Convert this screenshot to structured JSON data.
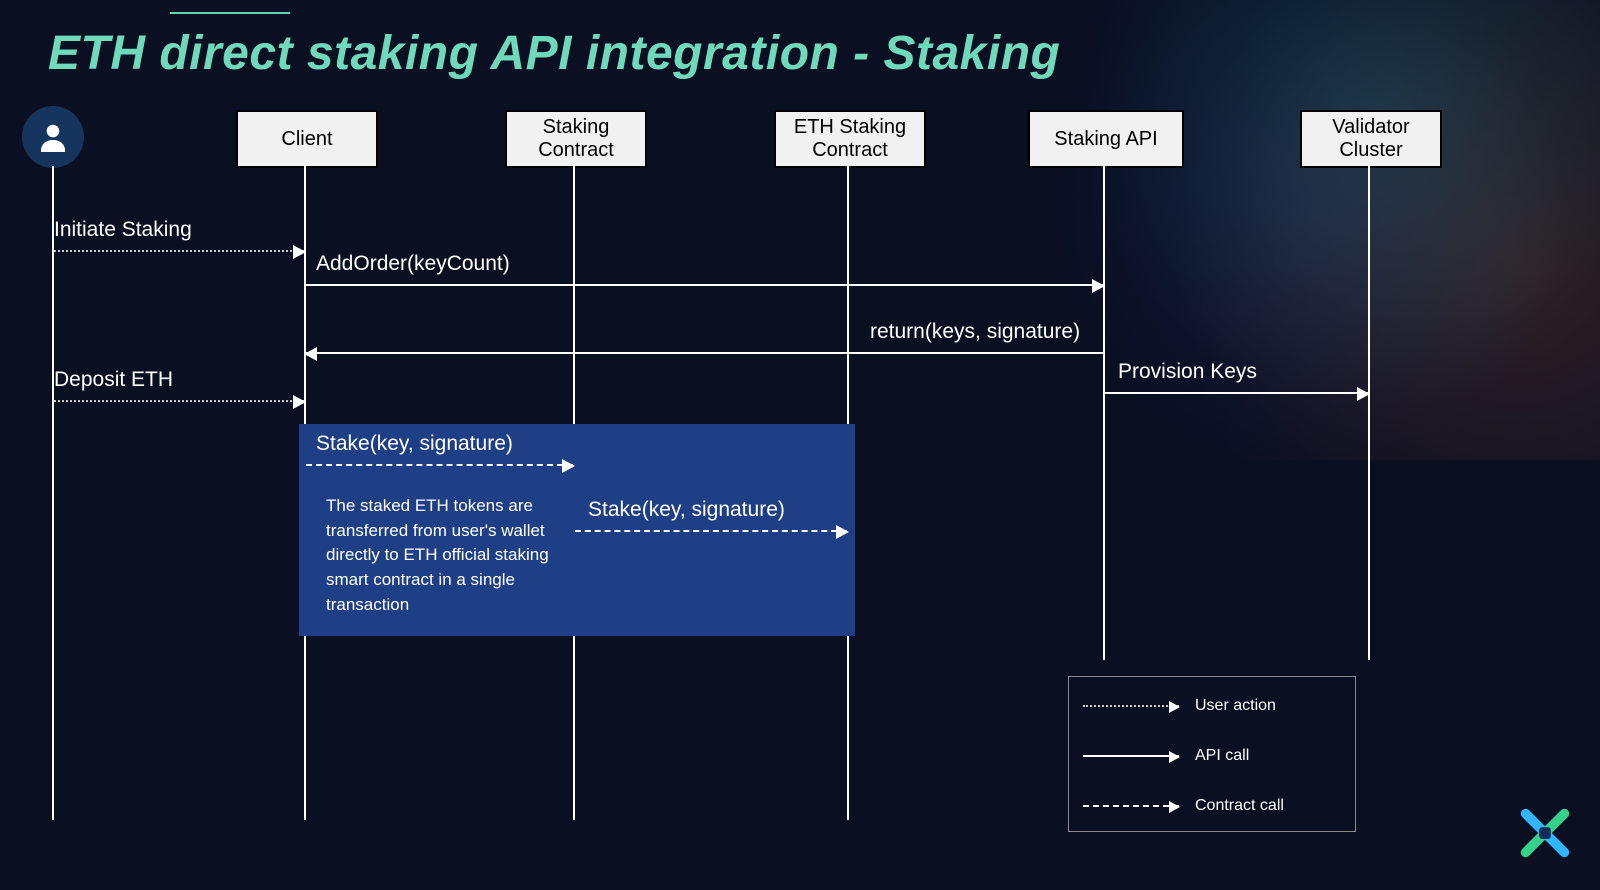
{
  "title": "ETH direct staking API integration - Staking",
  "participants": {
    "user": "User",
    "client": "Client",
    "stakingContract": "Staking\nContract",
    "ethStakingContract": "ETH Staking\nContract",
    "stakingApi": "Staking API",
    "validatorCluster": "Validator\nCluster"
  },
  "messages": {
    "initiateStaking": "Initiate Staking",
    "addOrder": "AddOrder(keyCount)",
    "returnKeys": "return(keys, signature)",
    "provisionKeys": "Provision Keys",
    "depositEth": "Deposit ETH",
    "stake1": "Stake(key, signature)",
    "stake2": "Stake(key, signature)"
  },
  "note": "The staked ETH tokens are transferred from user's wallet directly to ETH official staking smart contract in a single transaction",
  "legend": {
    "userAction": "User action",
    "apiCall": "API call",
    "contractCall": "Contract call"
  },
  "chart_data": {
    "type": "sequence-diagram",
    "participants": [
      "User",
      "Client",
      "Staking Contract",
      "ETH Staking Contract",
      "Staking API",
      "Validator Cluster"
    ],
    "messages": [
      {
        "from": "User",
        "to": "Client",
        "text": "Initiate Staking",
        "kind": "user-action"
      },
      {
        "from": "Client",
        "to": "Staking API",
        "text": "AddOrder(keyCount)",
        "kind": "api-call"
      },
      {
        "from": "Staking API",
        "to": "Client",
        "text": "return(keys, signature)",
        "kind": "api-call"
      },
      {
        "from": "Staking API",
        "to": "Validator Cluster",
        "text": "Provision Keys",
        "kind": "api-call"
      },
      {
        "from": "User",
        "to": "Client",
        "text": "Deposit ETH",
        "kind": "user-action"
      },
      {
        "from": "Client",
        "to": "Staking Contract",
        "text": "Stake(key, signature)",
        "kind": "contract-call"
      },
      {
        "from": "Staking Contract",
        "to": "ETH Staking Contract",
        "text": "Stake(key, signature)",
        "kind": "contract-call"
      }
    ],
    "annotation": {
      "covers": [
        "Client",
        "Staking Contract",
        "ETH Staking Contract"
      ],
      "text": "The staked ETH tokens are transferred from user's wallet directly to ETH official staking smart contract in a single transaction"
    },
    "legend": [
      {
        "style": "dotted",
        "label": "User action"
      },
      {
        "style": "solid",
        "label": "API call"
      },
      {
        "style": "dash-dot",
        "label": "Contract call"
      }
    ]
  }
}
